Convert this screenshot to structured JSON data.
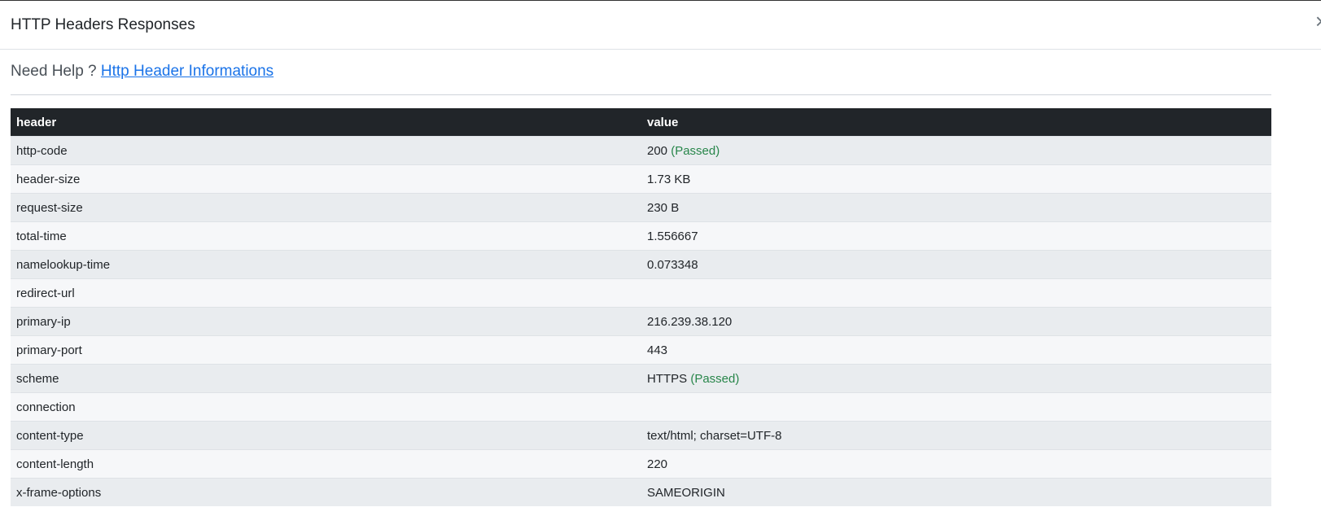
{
  "modal": {
    "title": "HTTP Headers Responses",
    "close_symbol": "×"
  },
  "help": {
    "prefix": "Need Help ?",
    "link_text": "Http Header Informations"
  },
  "table": {
    "columns": [
      "header",
      "value"
    ],
    "rows": [
      {
        "header": "http-code",
        "value": "200",
        "status": "(Passed)"
      },
      {
        "header": "header-size",
        "value": "1.73 KB",
        "status": ""
      },
      {
        "header": "request-size",
        "value": "230 B",
        "status": ""
      },
      {
        "header": "total-time",
        "value": "1.556667",
        "status": ""
      },
      {
        "header": "namelookup-time",
        "value": "0.073348",
        "status": ""
      },
      {
        "header": "redirect-url",
        "value": "",
        "status": ""
      },
      {
        "header": "primary-ip",
        "value": "216.239.38.120",
        "status": ""
      },
      {
        "header": "primary-port",
        "value": "443",
        "status": ""
      },
      {
        "header": "scheme",
        "value": "HTTPS",
        "status": "(Passed)"
      },
      {
        "header": "connection",
        "value": "",
        "status": ""
      },
      {
        "header": "content-type",
        "value": "text/html; charset=UTF-8",
        "status": ""
      },
      {
        "header": "content-length",
        "value": "220",
        "status": ""
      },
      {
        "header": "x-frame-options",
        "value": "SAMEORIGIN",
        "status": ""
      }
    ]
  },
  "colors": {
    "table_header_bg": "#212529",
    "passed": "#28864a",
    "link": "#1a73e8"
  }
}
